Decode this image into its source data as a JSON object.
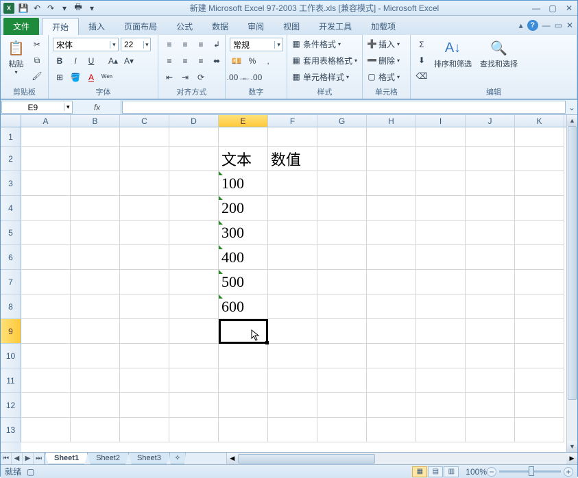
{
  "title": "新建 Microsoft Excel 97-2003 工作表.xls  [兼容模式] - Microsoft Excel",
  "tabs": {
    "file": "文件",
    "home": "开始",
    "insert": "插入",
    "pagelayout": "页面布局",
    "formulas": "公式",
    "data": "数据",
    "review": "审阅",
    "view": "视图",
    "developer": "开发工具",
    "addins": "加载项"
  },
  "ribbon": {
    "clipboard": {
      "paste": "粘贴",
      "label": "剪贴板"
    },
    "font": {
      "name": "宋体",
      "size": "22",
      "label": "字体"
    },
    "alignment": {
      "label": "对齐方式"
    },
    "number": {
      "format": "常规",
      "label": "数字"
    },
    "styles": {
      "conditional": "条件格式",
      "table": "套用表格格式",
      "cell": "单元格样式",
      "label": "样式"
    },
    "cells": {
      "insert": "插入",
      "delete": "删除",
      "format": "格式",
      "label": "单元格"
    },
    "editing": {
      "sort": "排序和筛选",
      "find": "查找和选择",
      "label": "编辑"
    }
  },
  "namebox": "E9",
  "formula": "",
  "columns": [
    "A",
    "B",
    "C",
    "D",
    "E",
    "F",
    "G",
    "H",
    "I",
    "J",
    "K"
  ],
  "rows": [
    "1",
    "2",
    "3",
    "4",
    "5",
    "6",
    "7",
    "8",
    "9",
    "10",
    "11",
    "12",
    "13"
  ],
  "active": {
    "col": "E",
    "row": "9"
  },
  "cells": {
    "E2": "文本",
    "F2": "数值",
    "E3": "100",
    "E4": "200",
    "E5": "300",
    "E6": "400",
    "E7": "500",
    "E8": "600"
  },
  "sheets": {
    "s1": "Sheet1",
    "s2": "Sheet2",
    "s3": "Sheet3"
  },
  "status": {
    "ready": "就绪",
    "zoom": "100%"
  }
}
